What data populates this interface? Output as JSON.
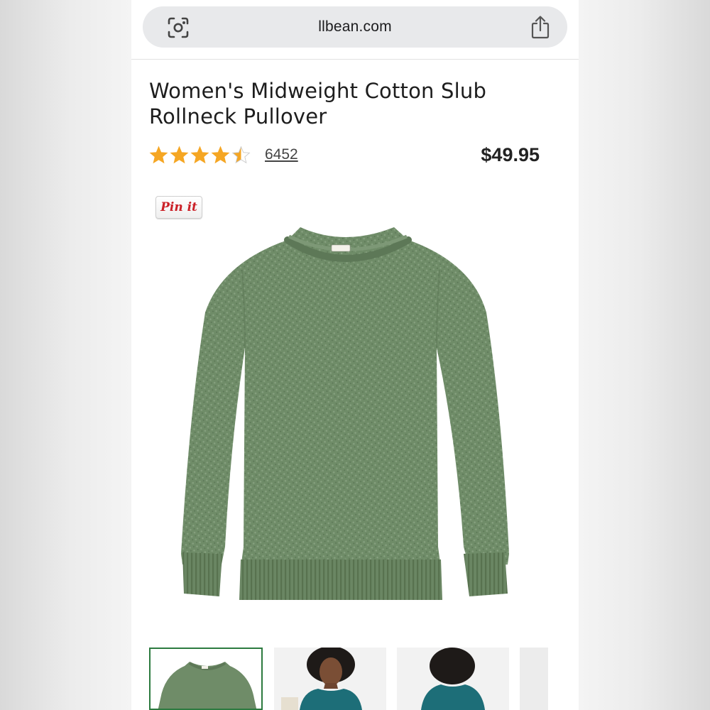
{
  "browser": {
    "url": "llbean.com",
    "lens_icon": "camera-lens-icon",
    "share_icon": "share-icon"
  },
  "product": {
    "title": "Women's Midweight Cotton Slub Rollneck Pullover",
    "rating": 4.5,
    "rating_max": 5,
    "review_count": "6452",
    "price": "$49.95"
  },
  "pin_button": {
    "label": "Pin it"
  },
  "main_image": {
    "kind": "sweater",
    "color": "#6f8c68"
  },
  "thumbnails": [
    {
      "kind": "sweater-flat",
      "color": "#6f8c68",
      "selected": true
    },
    {
      "kind": "model-front",
      "color": "#1d6e78",
      "selected": false
    },
    {
      "kind": "model-back",
      "color": "#1d6e78",
      "selected": false
    },
    {
      "kind": "partial",
      "color": "#d9d9d9",
      "selected": false
    }
  ],
  "colors": {
    "star": "#f5a623",
    "selected_border": "#2c7a3f",
    "pinterest_red": "#cb2027"
  }
}
